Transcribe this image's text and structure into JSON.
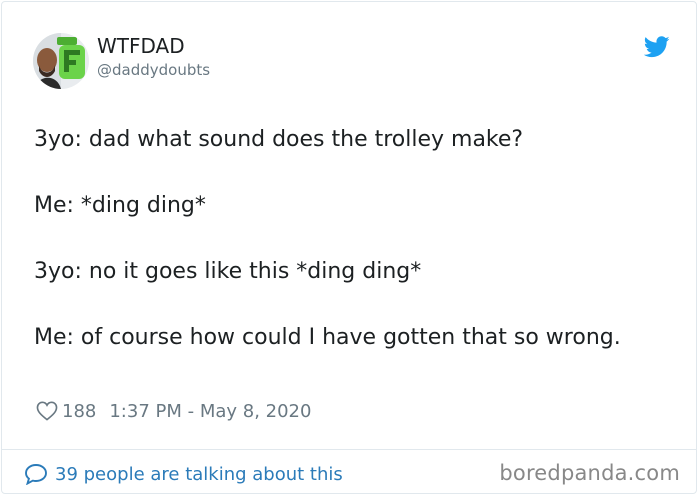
{
  "author": {
    "display_name": "WTFDAD",
    "handle": "@daddydoubts",
    "avatar": "avatar-photo-with-green-F-logo"
  },
  "tweet": {
    "paragraphs": [
      "3yo: dad what sound does the trolley make?",
      "Me: *ding ding*",
      "3yo: no it goes like this *ding ding*",
      "Me: of course how could I have gotten that so wrong."
    ]
  },
  "meta": {
    "likes": "188",
    "timestamp": "1:37 PM - May 8, 2020",
    "icon": "heart-icon"
  },
  "footer": {
    "conversation": "39 people are talking about this",
    "conversation_icon": "speech-bubble-icon"
  },
  "watermark": "boredpanda.com",
  "brand": {
    "icon": "twitter-bird-icon",
    "accent_color": "#1da1f2",
    "link_color": "#2b7bb9",
    "muted_color": "#697882"
  }
}
